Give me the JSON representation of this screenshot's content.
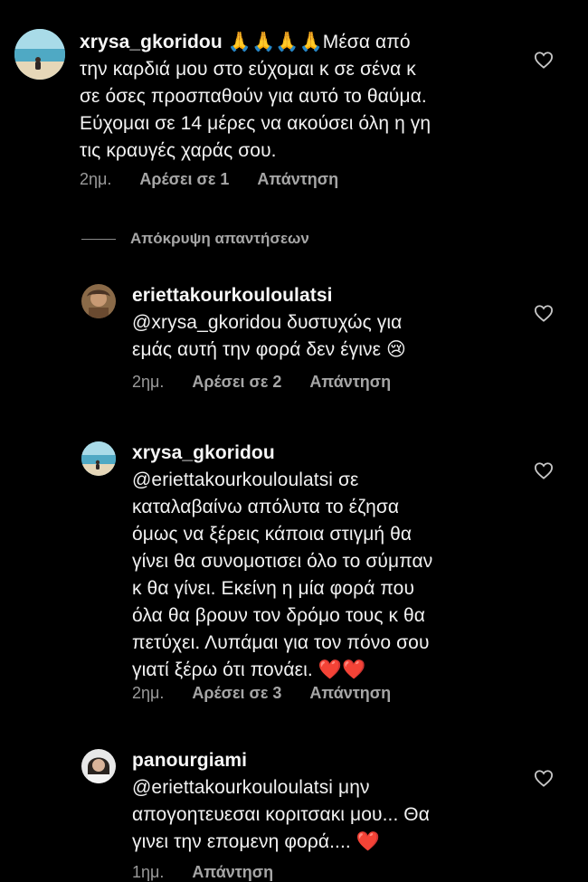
{
  "comments": [
    {
      "username": "xrysa_gkoridou",
      "text_lines": [
        " 🙏🙏🙏🙏Μέσα από",
        "την καρδιά μου στο εύχομαι κ σε σένα κ",
        "σε όσες προσπαθούν για αυτό το θαύμα.",
        "Εύχομαι σε 14 μέρες να ακούσει όλη η γη",
        "τις κραυγές χαράς σου."
      ],
      "time": "2ημ.",
      "likes": "Αρέσει σε 1",
      "reply": "Απάντηση"
    },
    {
      "username": "eriettakourkouloulatsi",
      "text_lines": [
        "@xrysa_gkoridou δυστυχώς για",
        "εμάς αυτή την φορά δεν έγινε 😢"
      ],
      "time": "2ημ.",
      "likes": "Αρέσει σε 2",
      "reply": "Απάντηση"
    },
    {
      "username": "xrysa_gkoridou",
      "text_lines": [
        "@eriettakourkouloulatsi σε",
        "καταλαβαίνω απόλυτα το έζησα",
        "όμως να ξέρεις κάποια στιγμή θα",
        "γίνει θα συνομοτισει όλο το σύμπαν",
        "κ θα γίνει. Εκείνη η μία φορά που",
        "όλα θα βρουν τον δρόμο τους κ θα",
        "πετύχει. Λυπάμαι για τον πόνο σου",
        "γιατί ξέρω ότι πονάει. ❤️❤️"
      ],
      "time": "2ημ.",
      "likes": "Αρέσει σε 3",
      "reply": "Απάντηση"
    },
    {
      "username": "panourgiami",
      "text_lines": [
        "@eriettakourkouloulatsi μην",
        "απογοητευεσαι κοριτσακι μου... Θα",
        "γινει την επομενη φορά.... ❤️"
      ],
      "time": "1ημ.",
      "likes": "",
      "reply": "Απάντηση"
    }
  ],
  "hide_replies": "Απόκρυψη απαντήσεων",
  "colors": {
    "background": "#000000",
    "text": "#f2f2f2",
    "meta": "#9a9a9a",
    "heart_emoji": "#e0202a"
  },
  "icons": [
    "heart-outline-icon"
  ]
}
